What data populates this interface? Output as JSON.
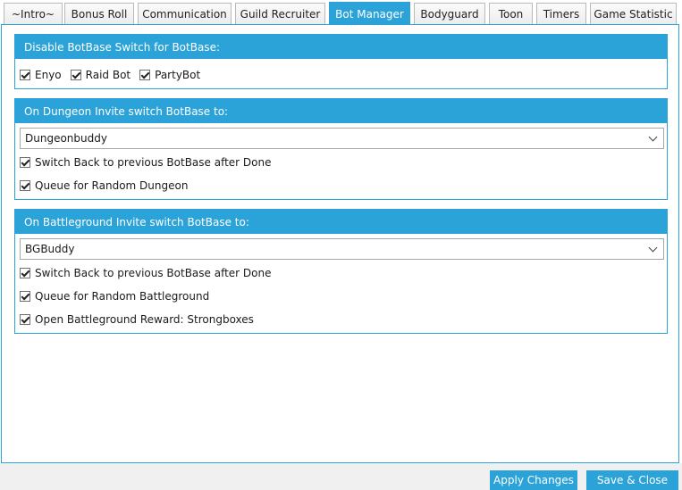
{
  "tabs": [
    {
      "label": "~Intro~"
    },
    {
      "label": "Bonus Roll"
    },
    {
      "label": "Communication"
    },
    {
      "label": "Guild Recruiter"
    },
    {
      "label": "Bot Manager"
    },
    {
      "label": "Bodyguard"
    },
    {
      "label": "Toon"
    },
    {
      "label": "Timers"
    },
    {
      "label": "Game Statistic"
    }
  ],
  "active_tab": "Bot Manager",
  "panel_disable": {
    "title": "Disable BotBase Switch for BotBase:",
    "options": [
      {
        "label": "Enyo",
        "checked": true
      },
      {
        "label": "Raid Bot",
        "checked": true
      },
      {
        "label": "PartyBot",
        "checked": true
      }
    ]
  },
  "panel_dungeon": {
    "title": "On Dungeon Invite switch BotBase to:",
    "selected": "Dungeonbuddy",
    "options": [
      {
        "label": "Switch Back to previous BotBase after Done",
        "checked": true
      },
      {
        "label": "Queue for Random Dungeon",
        "checked": true
      }
    ]
  },
  "panel_bg": {
    "title": "On Battleground Invite switch BotBase to:",
    "selected": "BGBuddy",
    "options": [
      {
        "label": "Switch Back to previous BotBase after Done",
        "checked": true
      },
      {
        "label": "Queue for Random Battleground",
        "checked": true
      },
      {
        "label": "Open Battleground Reward: Strongboxes",
        "checked": true
      }
    ]
  },
  "buttons": {
    "apply": "Apply Changes",
    "save_close": "Save & Close"
  },
  "colors": {
    "accent": "#2ba3d9"
  }
}
